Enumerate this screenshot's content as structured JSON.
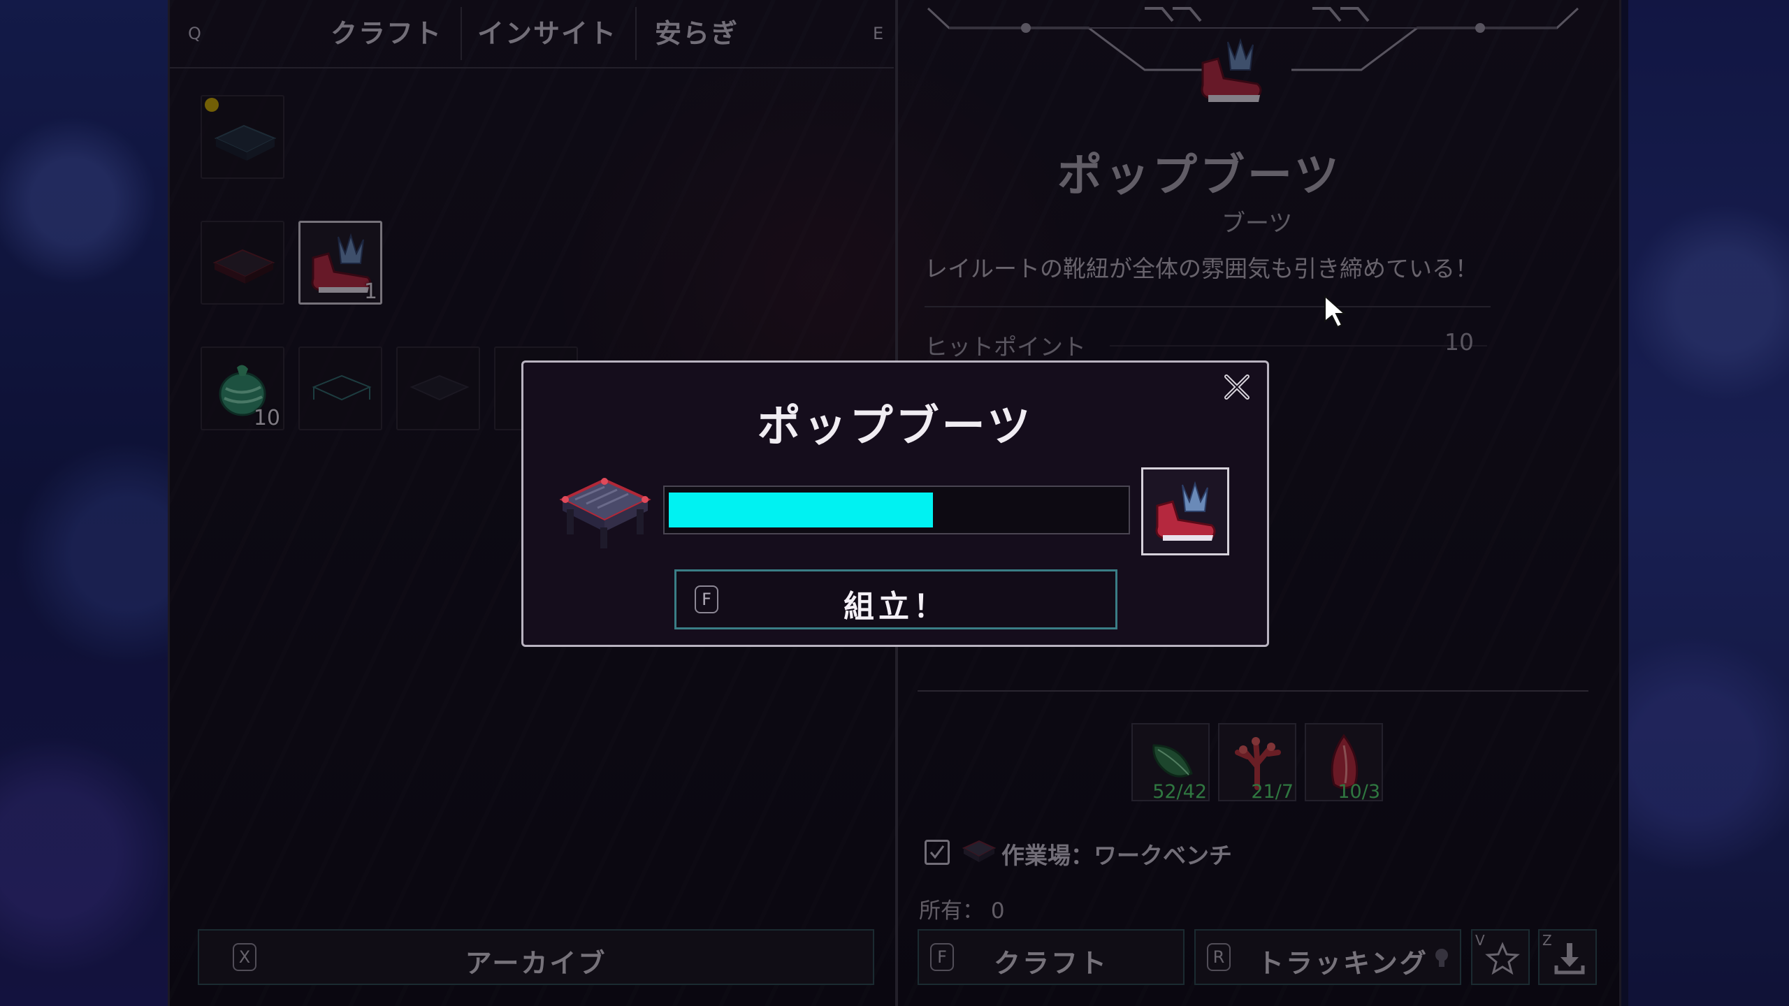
{
  "tabs": {
    "left_key": "Q",
    "right_key": "E",
    "items": [
      "クラフト",
      "インサイト",
      "安らぎ"
    ]
  },
  "grid": {
    "slots": [
      {
        "icon": "workbench-blueprint-icon",
        "count": ""
      },
      {
        "icon": "workbench-icon",
        "count": ""
      },
      {
        "icon": "pop-boots-icon",
        "count": "1",
        "selected": true
      },
      {
        "icon": "green-bag-icon",
        "count": "10"
      },
      {
        "icon": "outline-table-icon",
        "count": ""
      },
      {
        "icon": "dark-table-icon",
        "count": ""
      }
    ]
  },
  "archive_button": {
    "key": "X",
    "label": "アーカイブ"
  },
  "detail": {
    "title": "ポップブーツ",
    "type": "ブーツ",
    "description": "レイルートの靴紐が全体の雰囲気も引き締めている！",
    "stat_label": "ヒットポイント",
    "stat_value": "10",
    "ingredients": [
      {
        "icon": "green-leaf-icon",
        "count": "52/42"
      },
      {
        "icon": "red-coral-icon",
        "count": "21/7"
      },
      {
        "icon": "red-petal-icon",
        "count": "10/3"
      }
    ],
    "station": "作業場：ワークベンチ",
    "owned": "所有：",
    "owned_count": "0"
  },
  "bottom": {
    "craft_key": "F",
    "craft_label": "クラフト",
    "track_key": "R",
    "track_label": "トラッキング",
    "fav_key": "V",
    "dl_key": "Z"
  },
  "modal": {
    "title": "ポップブーツ",
    "progress": 0.58,
    "button_key": "F",
    "button_label": "組立！"
  },
  "colors": {
    "accent": "#00f2f2",
    "ingredient_count": "#4fd46a"
  }
}
